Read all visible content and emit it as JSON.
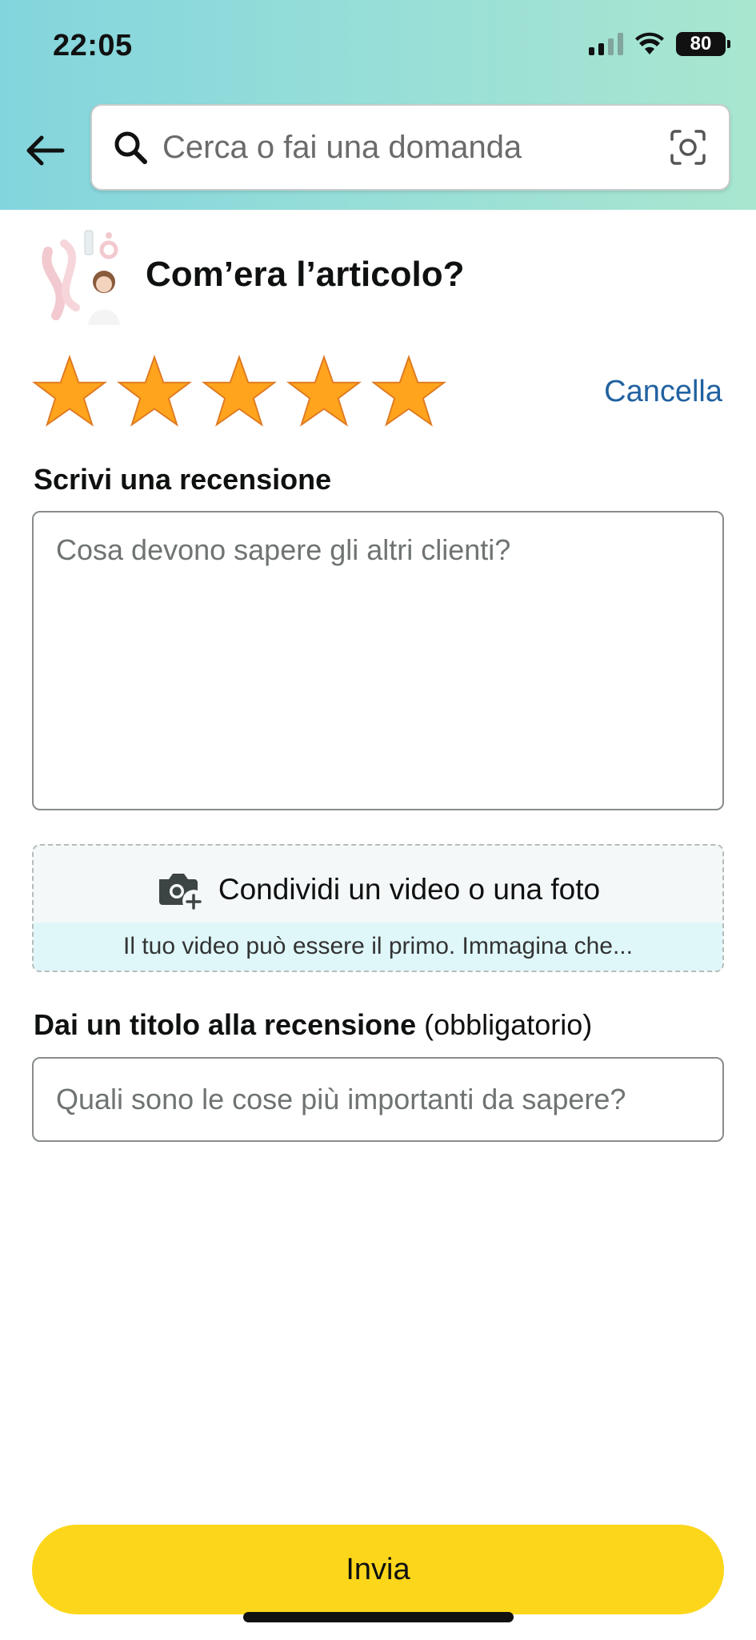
{
  "status_bar": {
    "time": "22:05",
    "battery": "80"
  },
  "header": {
    "search_placeholder": "Cerca o fai una domanda"
  },
  "product": {
    "question": "Com’era l’articolo?"
  },
  "rating": {
    "stars_total": 5,
    "stars_selected": 5,
    "cancel_label": "Cancella",
    "star_color": "#ffa41c"
  },
  "review": {
    "label": "Scrivi una recensione",
    "placeholder": "Cosa devono sapere gli altri clienti?"
  },
  "media_upload": {
    "label": "Condividi un video o una foto",
    "hint": "Il tuo video può essere il primo. Immagina che..."
  },
  "review_title": {
    "label": "Dai un titolo alla recensione",
    "required_note": "(obbligatorio)",
    "placeholder": "Quali sono le cose più importanti da sapere?"
  },
  "submit": {
    "label": "Invia",
    "color": "#fcd61a"
  }
}
